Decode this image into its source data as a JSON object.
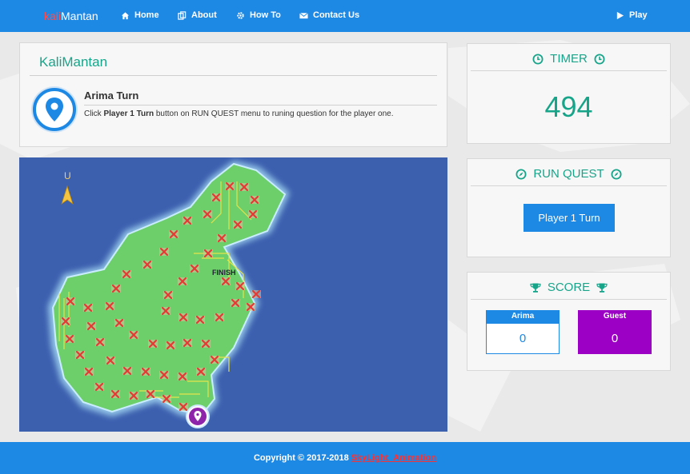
{
  "brand": {
    "part1": "kali",
    "part2": "Mantan"
  },
  "nav": {
    "home": "Home",
    "about": "About",
    "howto": "How To",
    "contact": "Contact Us",
    "play": "Play"
  },
  "info": {
    "title": "KaliMantan",
    "turn_title": "Arima Turn",
    "instruction_prefix": "Click",
    "instruction_bold": "Player 1 Turn",
    "instruction_suffix": "button on RUN QUEST menu to runing question for the player one."
  },
  "timer": {
    "title": "TIMER",
    "value": "494"
  },
  "run_quest": {
    "title": "RUN QUEST",
    "button": "Player 1 Turn"
  },
  "score": {
    "title": "SCORE",
    "player1": {
      "name": "Arima",
      "value": "0"
    },
    "player2": {
      "name": "Guest",
      "value": "0"
    }
  },
  "map": {
    "compass_label": "U",
    "finish_label": "FINISH"
  },
  "footer": {
    "copyright": "Copyright © 2017-2018",
    "credit": "SkyLight_Animation"
  },
  "colors": {
    "primary": "#1e88e5",
    "accent": "#17a58a",
    "brand_red": "#ff4d4d",
    "guest_purple": "#9c00c4",
    "sea": "#3c5fae",
    "land": "#6ccf6a",
    "marker_red": "#e53935"
  }
}
